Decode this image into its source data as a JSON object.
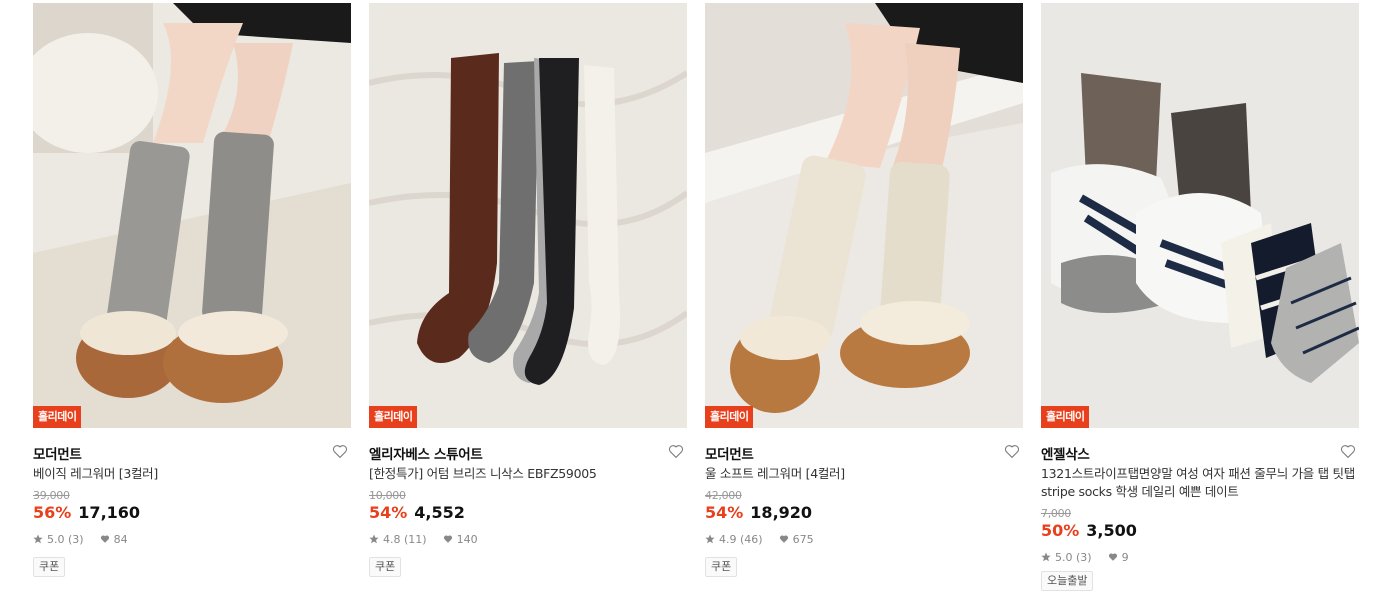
{
  "colors": {
    "accent": "#e8401c",
    "text": "#111111",
    "muted": "#888888"
  },
  "products": [
    {
      "badge": "홀리데이",
      "brand": "모더먼트",
      "title": "베이직 레그워머 [3컬러]",
      "original_price": "39,000",
      "discount": "56%",
      "price": "17,160",
      "rating": "5.0 (3)",
      "likes": "84",
      "tag": "쿠폰"
    },
    {
      "badge": "홀리데이",
      "brand": "엘리자베스 스튜어트",
      "title": "[한정특가] 어텀 브리즈 니삭스 EBFZ59005",
      "original_price": "10,000",
      "discount": "54%",
      "price": "4,552",
      "rating": "4.8 (11)",
      "likes": "140",
      "tag": "쿠폰"
    },
    {
      "badge": "홀리데이",
      "brand": "모더먼트",
      "title": "울 소프트 레그워머 [4컬러]",
      "original_price": "42,000",
      "discount": "54%",
      "price": "18,920",
      "rating": "4.9 (46)",
      "likes": "675",
      "tag": "쿠폰"
    },
    {
      "badge": "홀리데이",
      "brand": "엔젤삭스",
      "title": "1321스트라이프탭면양말 여성 여자 패션 줄무늬 가을 탭 팃탭 stripe socks 학생 데일리 예쁜 데이트",
      "original_price": "7,000",
      "discount": "50%",
      "price": "3,500",
      "rating": "5.0 (3)",
      "likes": "9",
      "tag": "오늘출발"
    }
  ]
}
